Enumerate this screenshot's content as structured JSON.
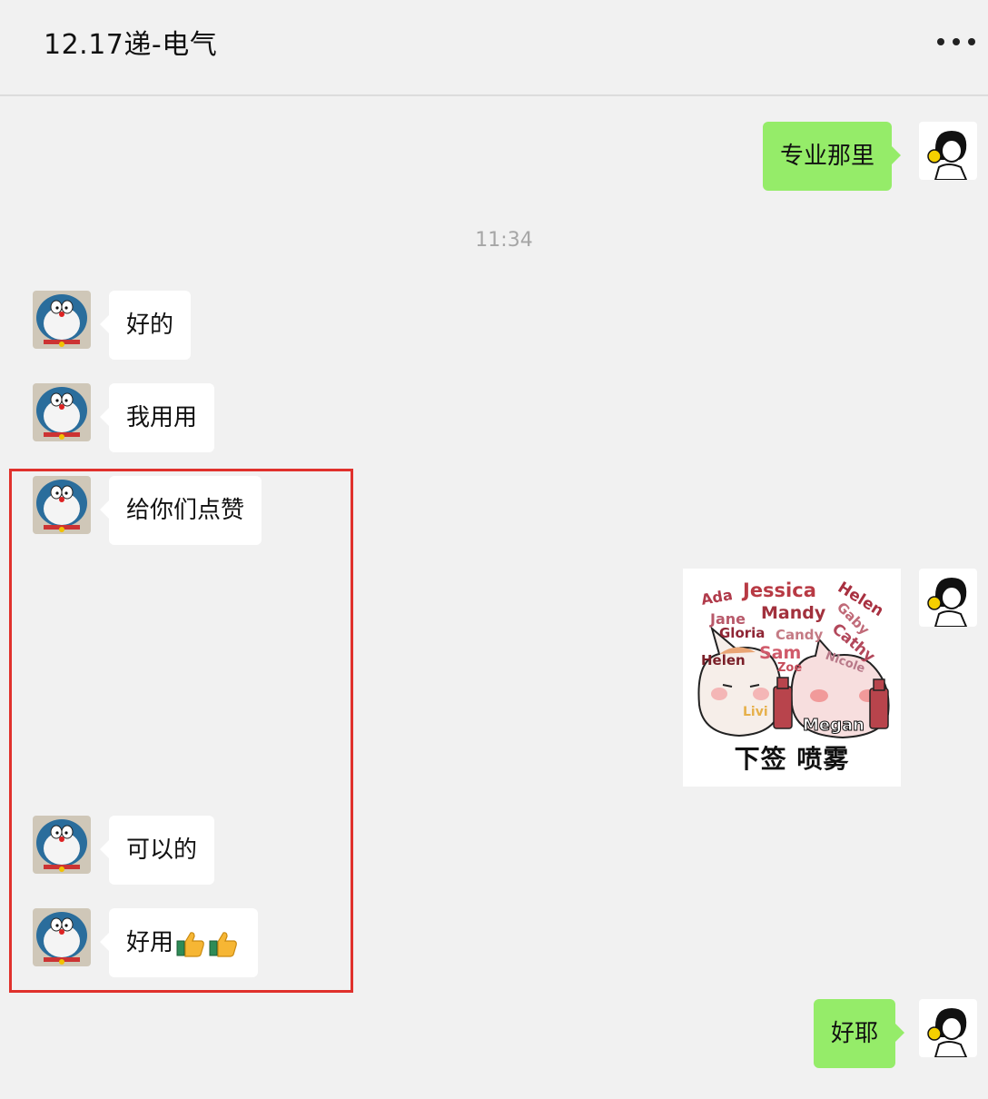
{
  "header": {
    "title": "12.17递-电气",
    "more_icon": "more-dots-icon"
  },
  "messages": [
    {
      "side": "out",
      "text": "专业那里"
    },
    {
      "side": "in",
      "text": "好的"
    },
    {
      "side": "in",
      "text": "我用用"
    },
    {
      "side": "in",
      "text": "给你们点赞"
    },
    {
      "side": "out",
      "type": "sticker"
    },
    {
      "side": "in",
      "text": "可以的"
    },
    {
      "side": "in",
      "text": "好用"
    },
    {
      "side": "out",
      "text": "好耶"
    }
  ],
  "timestamp": "11:34",
  "sticker": {
    "names": [
      "Ada",
      "Jessica",
      "Helen",
      "Jane",
      "Mandy",
      "Gaby",
      "Gloria",
      "Candy",
      "Cathy",
      "Helen",
      "Sam",
      "Nicole",
      "Zoe",
      "Livi",
      "Megan"
    ],
    "caption": "下签 喷雾"
  },
  "emoji": [
    "thumbs-up-icon",
    "thumbs-up-icon"
  ],
  "colors": {
    "background": "#f1f1f1",
    "outgoing_bubble": "#95ec69",
    "incoming_bubble": "#ffffff",
    "highlight_box": "#e0312c"
  }
}
